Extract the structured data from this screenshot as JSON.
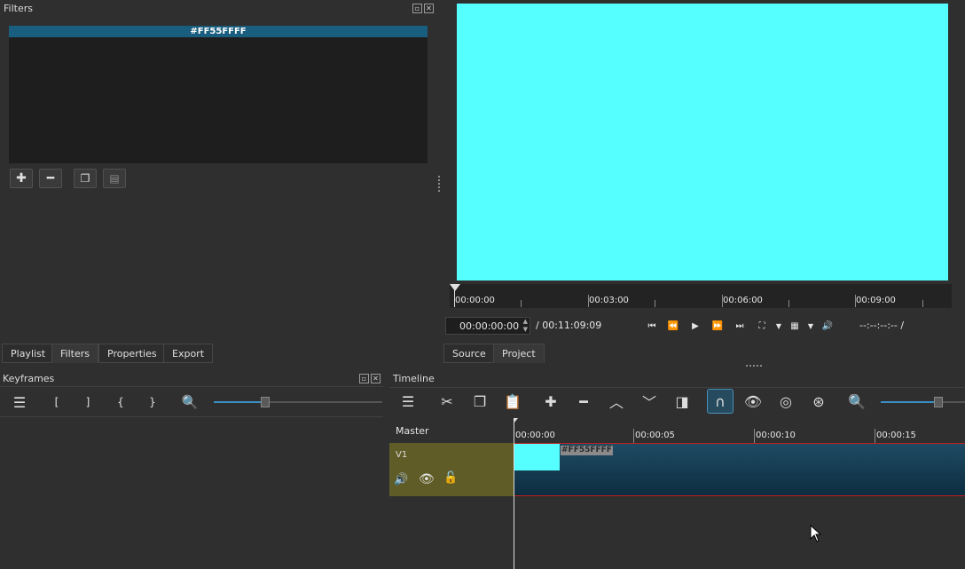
{
  "filters": {
    "title": "Filters",
    "selected_item": "#FF55FFFF",
    "buttons": [
      "add",
      "remove",
      "copy",
      "paste"
    ]
  },
  "preview": {
    "color": "#55FFFF",
    "ruler_labels": [
      "00:00:00",
      "00:03:00",
      "00:06:00",
      "00:09:00"
    ],
    "timecode": "00:00:00:00",
    "duration": "/ 00:11:09:09",
    "in_out": "--:--:--:-- /"
  },
  "tabs_left": [
    "Playlist",
    "Filters",
    "Properties",
    "Export"
  ],
  "tabs_right": [
    "Source",
    "Project"
  ],
  "keyframes": {
    "title": "Keyframes",
    "buttons": [
      "[",
      "]",
      "{",
      "}"
    ]
  },
  "timeline": {
    "title": "Timeline",
    "master_label": "Master",
    "track_label": "V1",
    "ruler_labels": [
      "00:00:00",
      "00:00:05",
      "00:00:10",
      "00:00:15"
    ],
    "clip_label": "#FF55FFFF",
    "track_color": "#605c27",
    "clip_color": "#55FFFF"
  }
}
